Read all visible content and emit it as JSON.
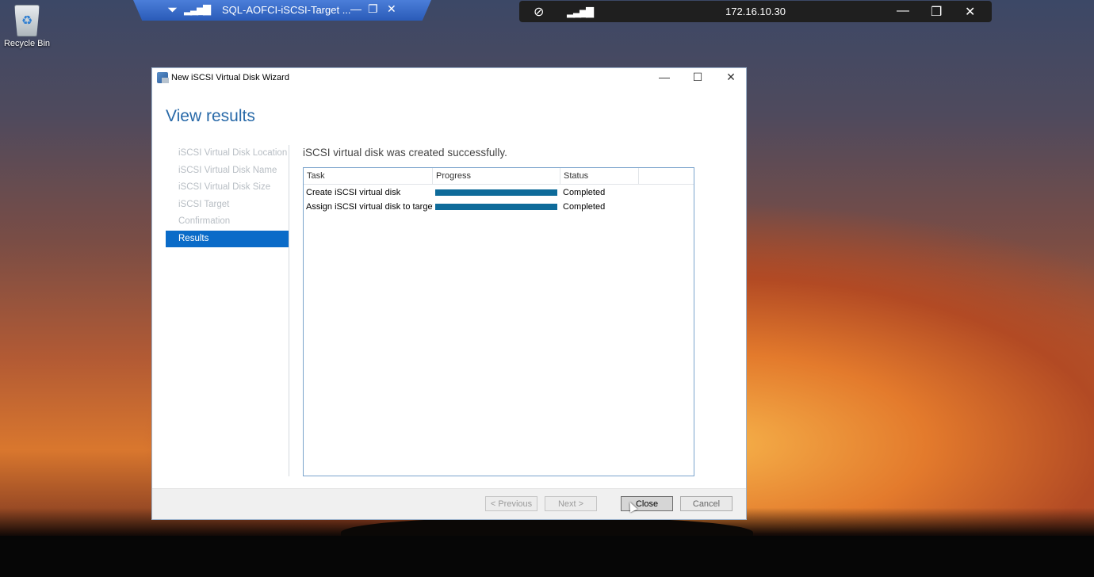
{
  "desktop": {
    "recycle_bin_label": "Recycle Bin"
  },
  "rdp_bar": {
    "title": "SQL-AOFCI-iSCSI-Target ...",
    "pin_icon": "pin-icon",
    "signal_icon": "signal-icon"
  },
  "remote_bar": {
    "address": "172.16.10.30"
  },
  "window": {
    "title": "New iSCSI Virtual Disk Wizard",
    "heading": "View results",
    "message": "iSCSI virtual disk was created successfully."
  },
  "steps": [
    {
      "label": "iSCSI Virtual Disk Location",
      "active": false
    },
    {
      "label": "iSCSI Virtual Disk Name",
      "active": false
    },
    {
      "label": "iSCSI Virtual Disk Size",
      "active": false
    },
    {
      "label": "iSCSI Target",
      "active": false
    },
    {
      "label": "Confirmation",
      "active": false
    },
    {
      "label": "Results",
      "active": true
    }
  ],
  "results": {
    "columns": [
      "Task",
      "Progress",
      "Status"
    ],
    "rows": [
      {
        "task": "Create iSCSI virtual disk",
        "progress": 100,
        "status": "Completed"
      },
      {
        "task": "Assign iSCSI virtual disk to target",
        "progress": 100,
        "status": "Completed"
      }
    ]
  },
  "buttons": {
    "previous": "< Previous",
    "next": "Next >",
    "close": "Close",
    "cancel": "Cancel"
  },
  "colors": {
    "accent": "#0a6bc8",
    "progress": "#0e6b9a",
    "heading": "#2869a8"
  }
}
